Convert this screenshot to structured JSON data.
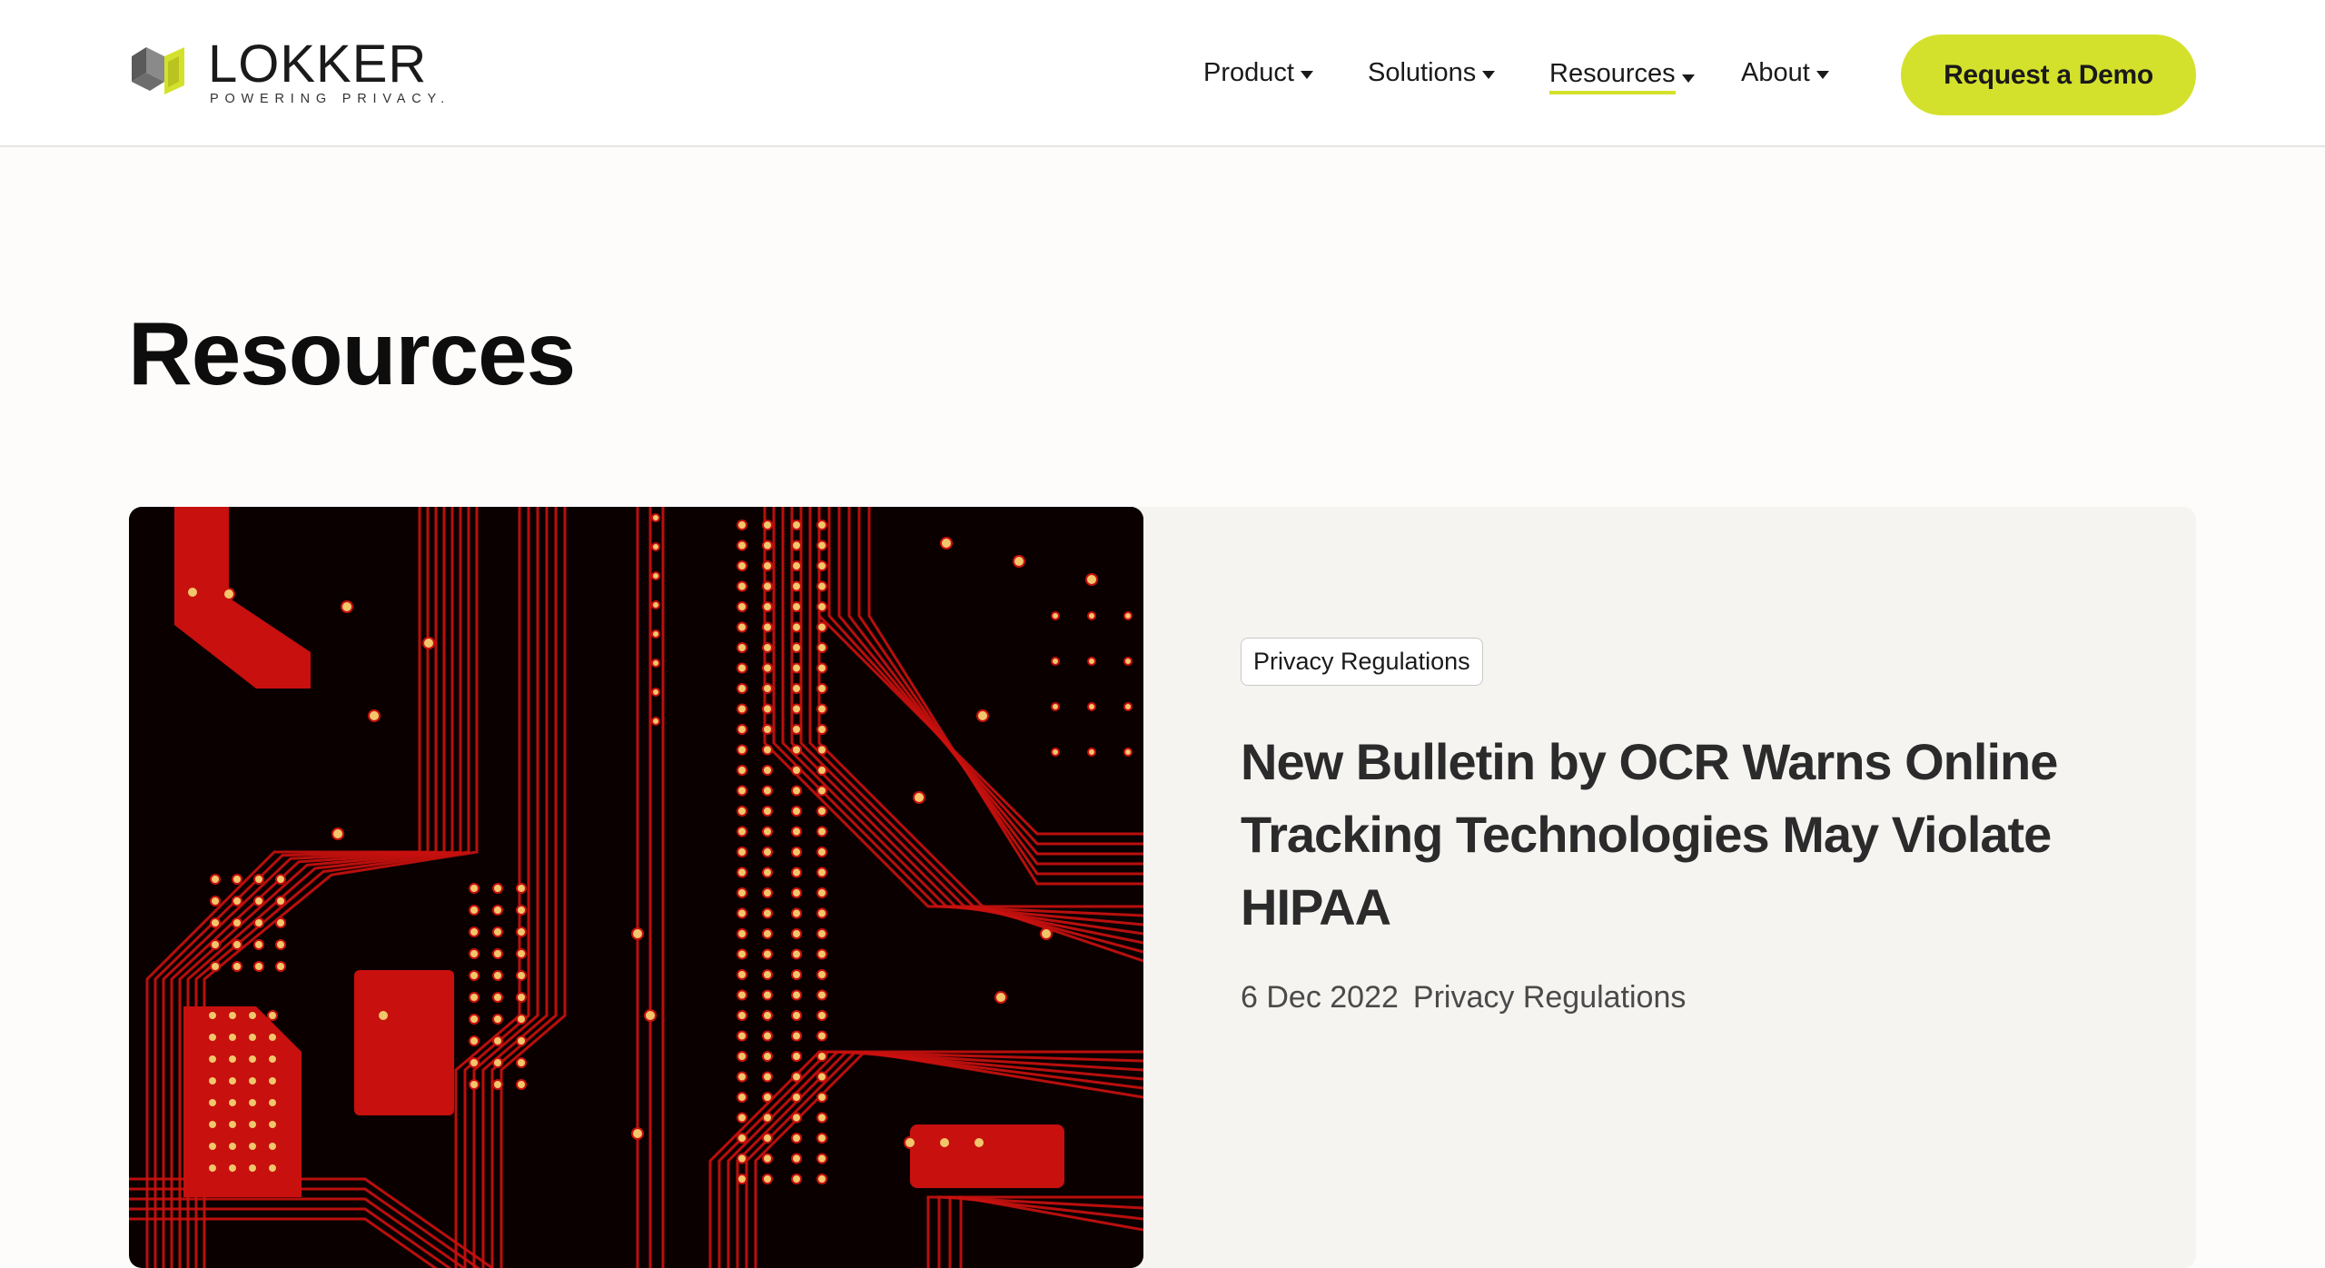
{
  "brand": {
    "name": "LOKKER",
    "tagline": "POWERING PRIVACY.",
    "colors": {
      "accent": "#d4e12c",
      "logo_dark": "#5a5a5a",
      "logo_mid": "#8a8a8a"
    }
  },
  "nav": {
    "items": [
      {
        "label": "Product"
      },
      {
        "label": "Solutions"
      },
      {
        "label": "Resources",
        "active": true
      },
      {
        "label": "About"
      }
    ],
    "cta_label": "Request a Demo"
  },
  "page": {
    "title": "Resources"
  },
  "featured_post": {
    "tag": "Privacy Regulations",
    "title": "New Bulletin by OCR Warns Online Tracking Technologies May Violate HIPAA",
    "date": "6 Dec 2022",
    "category": "Privacy Regulations",
    "image_icon": "circuit-board-image",
    "image_colors": {
      "trace": "#c8100e",
      "background": "#0b0000",
      "solder": "#f2c66b"
    }
  }
}
